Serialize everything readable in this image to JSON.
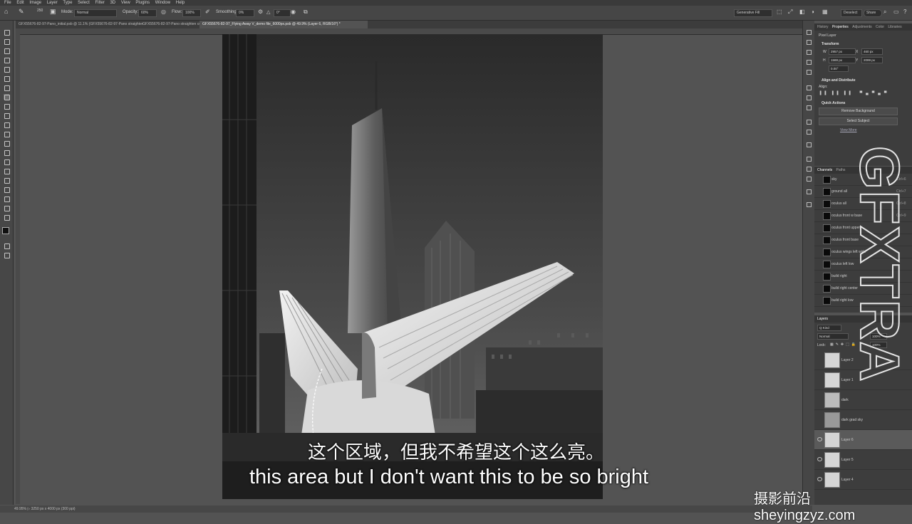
{
  "menu": [
    "File",
    "Edit",
    "Image",
    "Layer",
    "Type",
    "Select",
    "Filter",
    "3D",
    "View",
    "Plugins",
    "Window",
    "Help"
  ],
  "options": {
    "mode_label": "Mode:",
    "mode_value": "Normal",
    "opacity_label": "Opacity:",
    "opacity_value": "60%",
    "flow_label": "Flow:",
    "flow_value": "100%",
    "smoothing_label": "Smoothing:",
    "smoothing_value": "0%",
    "angle_value": "0°",
    "brush_size": "250",
    "generative_fill": "Generative Fill",
    "deselect": "Deselect",
    "share": "Share"
  },
  "tabs": [
    "GFX55676-82-97-Pano_initial.psb @ 11.1% (GFX55676-82-97-Pano straighten curve, RGB/16*) *",
    "GFX55676-82-97-Pano straighten curve, RGB/16*) *",
    "GFX55676-82-97_Flying Away V_demo file_6000px.psb @ 49.9% (Layer 6, RGB/16*) *"
  ],
  "status": "49.95% ▷ 3250 px x 4000 px (300 ppi)",
  "panels": {
    "top_tabs": [
      "History",
      "Properties",
      "Adjustments",
      "Color",
      "Libraries"
    ],
    "pixel_layer": "Pixel Layer",
    "transform_title": "Transform",
    "w_label": "W",
    "w_value": "2957 px",
    "x_label": "X",
    "x_value": "460 px",
    "h_label": "H",
    "h_value": "1588 px",
    "y_label": "Y",
    "y_value": "2099 px",
    "angle": "0.00°",
    "align_title": "Align and Distribute",
    "align_label": "Align:",
    "quick_actions_title": "Quick Actions",
    "remove_background": "Remove Background",
    "select_subject": "Select Subject",
    "view_more": "View More",
    "channel_tabs": [
      "Channels",
      "Paths"
    ],
    "channels": [
      {
        "name": "sky",
        "key": "Ctrl+6"
      },
      {
        "name": "ground all",
        "key": "Ctrl+7"
      },
      {
        "name": "oculus all",
        "key": "Ctrl+8"
      },
      {
        "name": "oculus front w base",
        "key": "Ctrl+9"
      },
      {
        "name": "oculus front upper",
        "key": ""
      },
      {
        "name": "oculus front base",
        "key": ""
      },
      {
        "name": "oculus wings left wide",
        "key": ""
      },
      {
        "name": "oculus left low",
        "key": ""
      },
      {
        "name": "build right",
        "key": ""
      },
      {
        "name": "build right center",
        "key": ""
      },
      {
        "name": "build right low",
        "key": ""
      }
    ],
    "layers_tab": "Layers",
    "kind_label": "Q Kind",
    "blend_mode": "Normal",
    "opacity": "100%",
    "lock_label": "Lock:",
    "fill": "100%",
    "layers": [
      {
        "name": "Layer 2",
        "visible": false
      },
      {
        "name": "Layer 1",
        "visible": false
      },
      {
        "name": "dark",
        "visible": false
      },
      {
        "name": "dark grad sky",
        "visible": false
      },
      {
        "name": "Layer 6",
        "visible": true
      },
      {
        "name": "Layer 5",
        "visible": true
      },
      {
        "name": "Layer 4",
        "visible": true
      }
    ]
  },
  "subtitle": {
    "cn": "这个区域，但我不希望这个这么亮。",
    "en": "this area but I don't want this to be so bright"
  },
  "watermarks": {
    "site": "摄影前沿 sheyingzyz.com",
    "vertical": "GFXTRA"
  }
}
